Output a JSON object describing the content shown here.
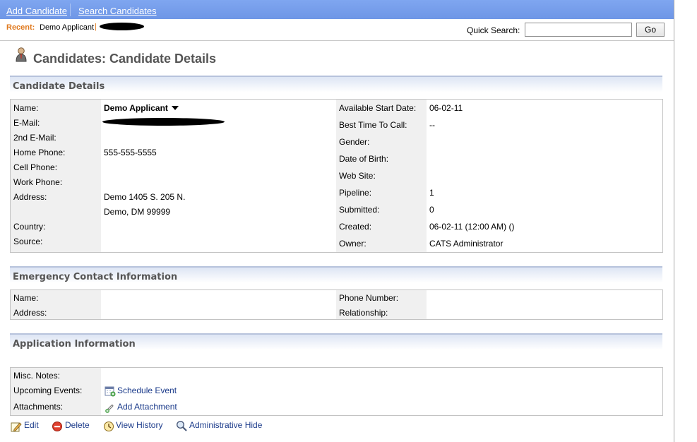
{
  "nav": {
    "add_candidate": "Add Candidate",
    "search_candidates": "Search Candidates"
  },
  "recent": {
    "label": "Recent:",
    "item": "Demo Applicant",
    "pipe": "|"
  },
  "quick_search": {
    "label": "Quick Search:",
    "value": "",
    "button": "Go"
  },
  "page_title": "Candidates: Candidate Details",
  "candidate": {
    "section_title": "Candidate Details",
    "left": [
      {
        "label": "Name:",
        "value": "Demo Applicant"
      },
      {
        "label": "E-Mail:",
        "value": ""
      },
      {
        "label": "2nd E-Mail:",
        "value": ""
      },
      {
        "label": "Home Phone:",
        "value": "555-555-5555"
      },
      {
        "label": "Cell Phone:",
        "value": ""
      },
      {
        "label": "Work Phone:",
        "value": ""
      },
      {
        "label": "Address:",
        "value": "Demo 1405 S. 205 N.",
        "value2": "Demo, DM 99999"
      },
      {
        "label": "Country:",
        "value": ""
      },
      {
        "label": "Source:",
        "value": ""
      }
    ],
    "right": [
      {
        "label": "Available Start Date:",
        "value": "06-02-11"
      },
      {
        "label": "Best Time To Call:",
        "value": "--"
      },
      {
        "label": "Gender:",
        "value": ""
      },
      {
        "label": "Date of Birth:",
        "value": ""
      },
      {
        "label": "Web Site:",
        "value": ""
      },
      {
        "label": "Pipeline:",
        "value": "1"
      },
      {
        "label": "Submitted:",
        "value": "0"
      },
      {
        "label": "Created:",
        "value": "06-02-11 (12:00 AM) ()"
      },
      {
        "label": "Owner:",
        "value": "CATS Administrator"
      }
    ]
  },
  "emergency": {
    "section_title": "Emergency Contact Information",
    "left": [
      {
        "label": "Name:",
        "value": ""
      },
      {
        "label": "Address:",
        "value": ""
      }
    ],
    "right": [
      {
        "label": "Phone Number:",
        "value": ""
      },
      {
        "label": "Relationship:",
        "value": ""
      }
    ]
  },
  "application": {
    "section_title": "Application Information",
    "rows": [
      {
        "label": "Misc. Notes:",
        "value": ""
      },
      {
        "label": "Upcoming Events:",
        "value": "Schedule Event",
        "icon": "calendar-add-icon"
      },
      {
        "label": "Attachments:",
        "value": "Add Attachment",
        "icon": "paperclip-add-icon"
      }
    ]
  },
  "actions": [
    {
      "label": "Edit",
      "icon": "edit-icon"
    },
    {
      "label": "Delete",
      "icon": "delete-icon"
    },
    {
      "label": "View History",
      "icon": "history-icon"
    },
    {
      "label": "Administrative Hide",
      "icon": "magnifier-icon"
    }
  ],
  "colors": {
    "topbar": "#7fa6f0",
    "recent_label": "#e07a1f",
    "link": "#1a3a8a",
    "label_bg": "#f0f0f0"
  }
}
